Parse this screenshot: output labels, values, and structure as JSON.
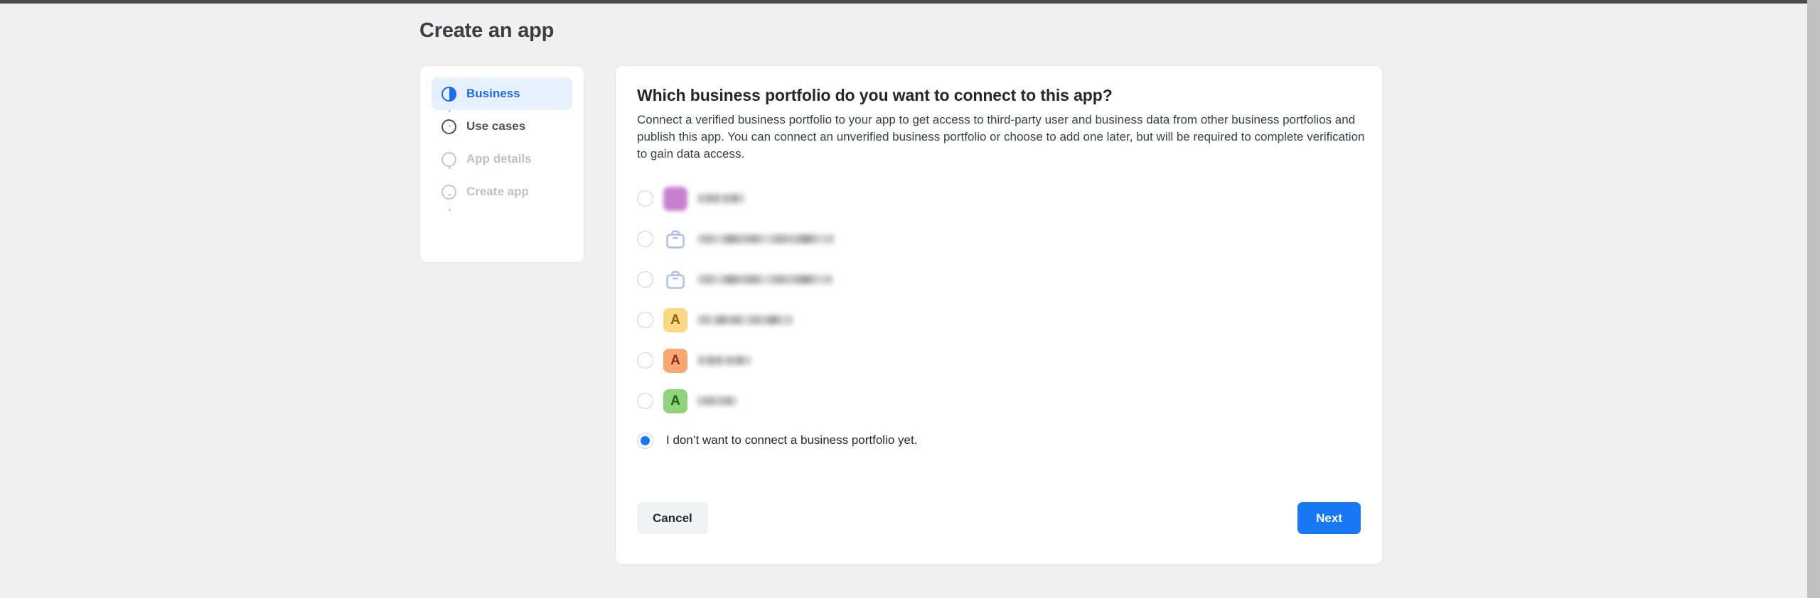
{
  "page": {
    "title": "Create an app",
    "background_color": "#f0f0f0",
    "accent_color": "#1877f2"
  },
  "stepper": {
    "steps": [
      {
        "label": "Business",
        "icon": "half-filled-circle-icon",
        "state": "active"
      },
      {
        "label": "Use cases",
        "icon": "empty-circle-icon",
        "state": "current"
      },
      {
        "label": "App details",
        "icon": "empty-circle-icon",
        "state": "upcoming"
      },
      {
        "label": "Create app",
        "icon": "empty-circle-icon",
        "state": "upcoming"
      }
    ]
  },
  "main": {
    "heading": "Which business portfolio do you want to connect to this app?",
    "body": "Connect a verified business portfolio to your app to get access to third-party user and business data from other business portfolios and publish this app. You can connect an unverified business portfolio or choose to add one later, but will be required to complete verification to gain data access.",
    "portfolios": [
      {
        "name": "",
        "redacted": true,
        "icon": "portfolio-avatar-icon",
        "icon_type": "square",
        "icon_bg": "#c77fd0",
        "icon_fg": "#ffffff",
        "icon_letter": "",
        "selected": false,
        "name_width": 66
      },
      {
        "name": "",
        "redacted": true,
        "icon": "briefcase-icon",
        "icon_type": "briefcase",
        "icon_bg": "#aebce8",
        "icon_fg": "#aebce8",
        "icon_letter": "",
        "selected": false,
        "name_width": 192
      },
      {
        "name": "",
        "redacted": true,
        "icon": "briefcase-icon",
        "icon_type": "briefcase",
        "icon_bg": "#aebce8",
        "icon_fg": "#aebce8",
        "icon_letter": "",
        "selected": false,
        "name_width": 190
      },
      {
        "name": "",
        "redacted": true,
        "icon": "letter-avatar-icon",
        "icon_type": "letter",
        "icon_bg": "#fbd881",
        "icon_fg": "#8a6116",
        "icon_letter": "A",
        "selected": false,
        "name_width": 134
      },
      {
        "name": "",
        "redacted": true,
        "icon": "letter-avatar-icon",
        "icon_type": "letter",
        "icon_bg": "#f7a872",
        "icon_fg": "#8c2f20",
        "icon_letter": "A",
        "selected": false,
        "name_width": 75
      },
      {
        "name": "",
        "redacted": true,
        "icon": "letter-avatar-icon",
        "icon_type": "letter",
        "icon_bg": "#8fd37a",
        "icon_fg": "#20601f",
        "icon_letter": "A",
        "selected": false,
        "name_width": 55
      }
    ],
    "no_connect_option": {
      "label": "I don’t want to connect a business portfolio yet.",
      "selected": true
    }
  },
  "footer": {
    "cancel_label": "Cancel",
    "next_label": "Next"
  }
}
